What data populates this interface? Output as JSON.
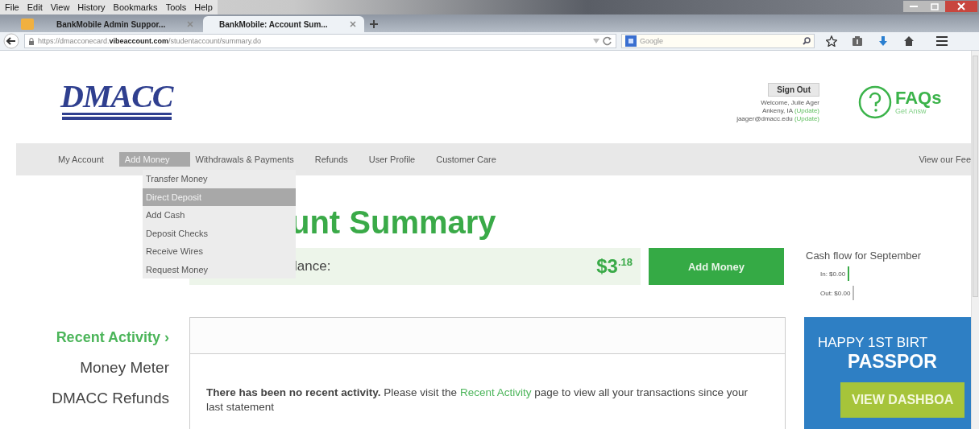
{
  "browser": {
    "menu": [
      "File",
      "Edit",
      "View",
      "History",
      "Bookmarks",
      "Tools",
      "Help"
    ],
    "tabs": [
      {
        "title": "BankMobile Admin Suppor...",
        "selected": false
      },
      {
        "title": "BankMobile: Account Sum...",
        "selected": true
      }
    ],
    "url": {
      "prefix": "https://dmacconecard.",
      "domain": "vibeaccount.com",
      "path": "/studentaccount/summary.do"
    },
    "search_placeholder": "Google"
  },
  "header": {
    "logo": "DMACC",
    "sign_out": "Sign Out",
    "welcome": "Welcome, Julie Ager",
    "lines": [
      {
        "text": "Ankeny, IA",
        "link": "(Update)"
      },
      {
        "text": "jaager@dmacc.edu",
        "link": "(Update)"
      }
    ],
    "faq_title": "FAQs",
    "faq_subtitle": "Get Answ"
  },
  "nav": {
    "items": [
      {
        "label": "My Account",
        "selected": false
      },
      {
        "label": "Add Money",
        "selected": true
      },
      {
        "label": "Withdrawals & Payments",
        "selected": false
      },
      {
        "label": "Refunds",
        "selected": false
      },
      {
        "label": "User Profile",
        "selected": false
      },
      {
        "label": "Customer Care",
        "selected": false
      }
    ],
    "fee_link": "View our Fee",
    "dropdown": [
      {
        "label": "Transfer Money",
        "selected": false
      },
      {
        "label": "Direct Deposit",
        "selected": true
      },
      {
        "label": "Add Cash",
        "selected": false
      },
      {
        "label": "Deposit Checks",
        "selected": false
      },
      {
        "label": "Receive Wires",
        "selected": false
      },
      {
        "label": "Request Money",
        "selected": false
      }
    ]
  },
  "summary": {
    "heading": "unt Summary",
    "balance_label": "lance:",
    "balance": "$3$^{.18}$",
    "add_button": "Add Money"
  },
  "cash_flow": {
    "title": "Cash flow for September",
    "rows": [
      "In: $0.00",
      "Out: $0.00"
    ]
  },
  "sidebar": [
    {
      "label": "Recent Activity ›",
      "selected": true
    },
    {
      "label": "Money Meter",
      "selected": false
    },
    {
      "label": "DMACC Refunds",
      "selected": false
    }
  ],
  "activity": {
    "before": "**There has been no recent activity.** Please visit the",
    "link": "Recent Activity",
    "after": "page to view all your transactions since your last statement"
  },
  "promo": {
    "line1": "HAPPY 1ST BIRT",
    "line2": "PASSPOR",
    "button": "VIEW DASHBOA"
  }
}
